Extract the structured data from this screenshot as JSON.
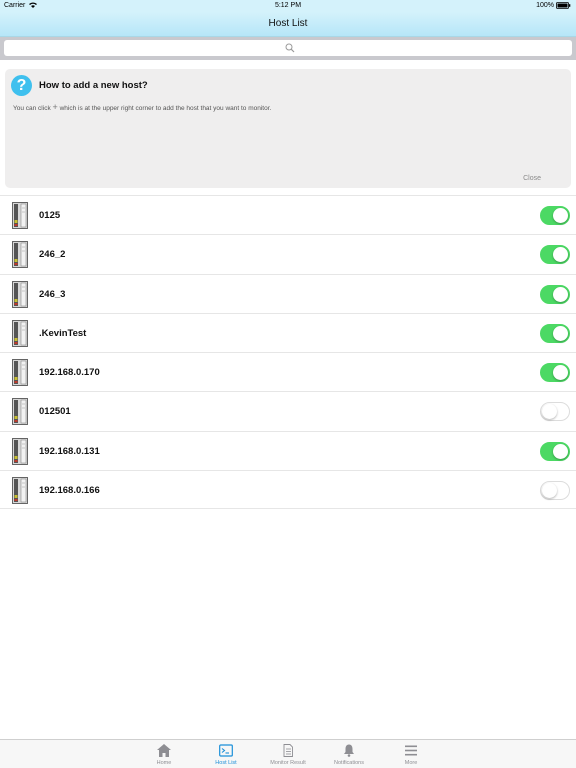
{
  "status_bar": {
    "carrier": "Carrier",
    "time": "5:12 PM",
    "battery": "100%"
  },
  "nav": {
    "title": "Host List"
  },
  "search": {
    "placeholder": "",
    "icon": "search-icon"
  },
  "help": {
    "icon_glyph": "?",
    "title": "How to add a new host?",
    "text_before": "You can click",
    "plus_glyph": "+",
    "text_after": "which is at the upper right corner to add the host that you want to monitor.",
    "close_label": "Close"
  },
  "hosts": [
    {
      "name": "0125",
      "enabled": true
    },
    {
      "name": "246_2",
      "enabled": true
    },
    {
      "name": "246_3",
      "enabled": true
    },
    {
      "name": ".KevinTest",
      "enabled": true
    },
    {
      "name": "192.168.0.170",
      "enabled": true
    },
    {
      "name": "012501",
      "enabled": false
    },
    {
      "name": "192.168.0.131",
      "enabled": true
    },
    {
      "name": "192.168.0.166",
      "enabled": false
    }
  ],
  "tabs": [
    {
      "label": "Home",
      "icon": "home-icon",
      "active": false
    },
    {
      "label": "Host List",
      "icon": "terminal-icon",
      "active": true
    },
    {
      "label": "Monitor Result",
      "icon": "document-icon",
      "active": false
    },
    {
      "label": "Notifications",
      "icon": "bell-icon",
      "active": false
    },
    {
      "label": "More",
      "icon": "menu-icon",
      "active": false
    }
  ],
  "colors": {
    "nav_bg": "#d4f2fb",
    "toggle_on": "#4cd964",
    "help_icon": "#3fc0ee",
    "tab_active": "#1b8fd9"
  }
}
